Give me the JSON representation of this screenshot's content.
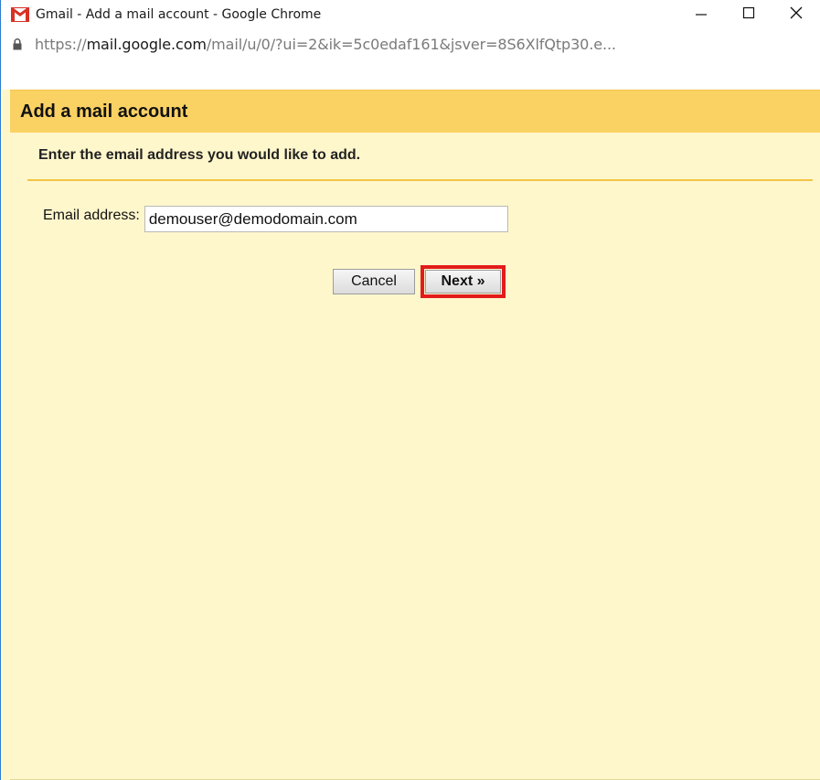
{
  "window": {
    "title": "Gmail - Add a mail account - Google Chrome",
    "controls": {
      "minimize": "minimize",
      "maximize": "maximize",
      "close": "close"
    }
  },
  "address_bar": {
    "url_scheme": "https://",
    "url_host": "mail.google.com",
    "url_path": "/mail/u/0/?ui=2&ik=5c0edaf161&jsver=8S6XlfQtp30.e..."
  },
  "dialog": {
    "title": "Add a mail account",
    "instruction": "Enter the email address you would like to add.",
    "email_label": "Email address:",
    "email_value": "demouser@demodomain.com",
    "cancel_label": "Cancel",
    "next_label": "Next »"
  },
  "colors": {
    "header_bg": "#fad163",
    "page_bg": "#fff7cc",
    "highlight": "#e31b1b",
    "window_border": "#2b7fd1"
  },
  "icons": {
    "app": "gmail-logo-icon",
    "lock": "lock-icon",
    "minimize": "minimize-icon",
    "maximize": "maximize-icon",
    "close": "close-icon"
  }
}
